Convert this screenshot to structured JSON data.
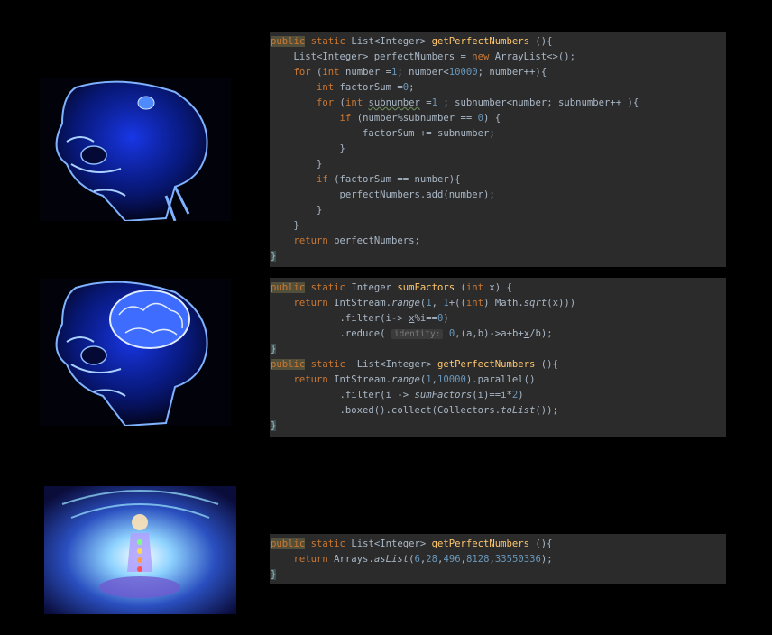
{
  "panel1": {
    "lines": [
      [
        [
          "public",
          "pub"
        ],
        [
          " static ",
          "kw"
        ],
        [
          "List<Integer> ",
          ""
        ],
        [
          "getPerfectNumbers",
          "fn"
        ],
        [
          " (){",
          ""
        ]
      ],
      [
        [
          "    List<Integer> perfectNumbers = ",
          ""
        ],
        [
          "new ",
          "kw"
        ],
        [
          "ArrayList<>();",
          ""
        ]
      ],
      [
        [
          "    ",
          ""
        ],
        [
          "for ",
          "kw"
        ],
        [
          "(",
          ""
        ],
        [
          "int ",
          "kw"
        ],
        [
          "number =",
          ""
        ],
        [
          "1",
          "num"
        ],
        [
          "; number<",
          ""
        ],
        [
          "10000",
          "num"
        ],
        [
          "; number++){",
          ""
        ]
      ],
      [
        [
          "        ",
          ""
        ],
        [
          "int ",
          "kw"
        ],
        [
          "factorSum =",
          ""
        ],
        [
          "0",
          "num"
        ],
        [
          ";",
          ""
        ]
      ],
      [
        [
          "        ",
          ""
        ],
        [
          "for ",
          "kw"
        ],
        [
          "(",
          ""
        ],
        [
          "int ",
          "kw"
        ],
        [
          "subnumber",
          "wave"
        ],
        [
          " =",
          ""
        ],
        [
          "1 ",
          "num"
        ],
        [
          "; subnumber<number; subnumber++ ){",
          ""
        ]
      ],
      [
        [
          "            ",
          ""
        ],
        [
          "if ",
          "kw"
        ],
        [
          "(number%subnumber == ",
          ""
        ],
        [
          "0",
          "num"
        ],
        [
          ") {",
          ""
        ]
      ],
      [
        [
          "                factorSum += subnumber;",
          ""
        ]
      ],
      [
        [
          "            }",
          ""
        ]
      ],
      [
        [
          "        }",
          ""
        ]
      ],
      [
        [
          "        ",
          ""
        ],
        [
          "if ",
          "kw"
        ],
        [
          "(factorSum == number){",
          ""
        ]
      ],
      [
        [
          "            perfectNumbers.add(number);",
          ""
        ]
      ],
      [
        [
          "        }",
          ""
        ]
      ],
      [
        [
          "    }",
          ""
        ]
      ],
      [
        [
          "    ",
          ""
        ],
        [
          "return ",
          "kw"
        ],
        [
          "perfectNumbers;",
          ""
        ]
      ],
      [
        [
          "}",
          "brace"
        ]
      ]
    ]
  },
  "panel2": {
    "lines": [
      [
        [
          "public",
          "pub"
        ],
        [
          " static ",
          "kw"
        ],
        [
          "Integer ",
          ""
        ],
        [
          "sumFactors",
          "fn"
        ],
        [
          " (",
          ""
        ],
        [
          "int ",
          "kw"
        ],
        [
          "x) {",
          ""
        ]
      ],
      [
        [
          "    ",
          ""
        ],
        [
          "return ",
          "kw"
        ],
        [
          "IntStream.",
          ""
        ],
        [
          "range",
          "it"
        ],
        [
          "(",
          ""
        ],
        [
          "1",
          "num"
        ],
        [
          ", ",
          ""
        ],
        [
          "1",
          "num"
        ],
        [
          "+((",
          ""
        ],
        [
          "int",
          "kw"
        ],
        [
          ") Math.",
          ""
        ],
        [
          "sqrt",
          "it"
        ],
        [
          "(x)))",
          ""
        ]
      ],
      [
        [
          "            .filter(i-> ",
          ""
        ],
        [
          "x",
          "und"
        ],
        [
          "%i==",
          ""
        ],
        [
          "0",
          "num"
        ],
        [
          ")",
          ""
        ]
      ],
      [
        [
          "            .reduce( ",
          ""
        ],
        [
          "identity:",
          "hint"
        ],
        [
          " ",
          ""
        ],
        [
          "0",
          "num"
        ],
        [
          ",(a,b)->a+b+",
          ""
        ],
        [
          "x",
          "und"
        ],
        [
          "/b);",
          ""
        ]
      ],
      [
        [
          "}",
          "brace"
        ]
      ],
      [
        [
          "public",
          "pub"
        ],
        [
          " static  ",
          "kw"
        ],
        [
          "List<Integer> ",
          ""
        ],
        [
          "getPerfectNumbers",
          "fn"
        ],
        [
          " (){",
          ""
        ]
      ],
      [
        [
          "    ",
          ""
        ],
        [
          "return ",
          "kw"
        ],
        [
          "IntStream.",
          ""
        ],
        [
          "range",
          "it"
        ],
        [
          "(",
          ""
        ],
        [
          "1",
          "num"
        ],
        [
          ",",
          ""
        ],
        [
          "10000",
          "num"
        ],
        [
          ").parallel()",
          ""
        ]
      ],
      [
        [
          "            .filter(i -> ",
          ""
        ],
        [
          "sumFactors",
          "it"
        ],
        [
          "(i)==i*",
          ""
        ],
        [
          "2",
          "num"
        ],
        [
          ")",
          ""
        ]
      ],
      [
        [
          "            .boxed().collect(Collectors.",
          ""
        ],
        [
          "toList",
          "it"
        ],
        [
          "());",
          ""
        ]
      ],
      [
        [
          "}",
          "brace"
        ]
      ]
    ]
  },
  "panel3": {
    "lines": [
      [
        [
          "public",
          "pub"
        ],
        [
          " static ",
          "kw"
        ],
        [
          "List<Integer> ",
          ""
        ],
        [
          "getPerfectNumbers",
          "fn"
        ],
        [
          " (){",
          ""
        ]
      ],
      [
        [
          "    ",
          ""
        ],
        [
          "return ",
          "kw"
        ],
        [
          "Arrays.",
          ""
        ],
        [
          "asList",
          "it"
        ],
        [
          "(",
          ""
        ],
        [
          "6",
          "num"
        ],
        [
          ",",
          ""
        ],
        [
          "28",
          "num"
        ],
        [
          ",",
          ""
        ],
        [
          "496",
          "num"
        ],
        [
          ",",
          ""
        ],
        [
          "8128",
          "num"
        ],
        [
          ",",
          ""
        ],
        [
          "33550336",
          "num"
        ],
        [
          ");",
          ""
        ]
      ],
      [
        [
          "}",
          "brace"
        ]
      ]
    ]
  }
}
